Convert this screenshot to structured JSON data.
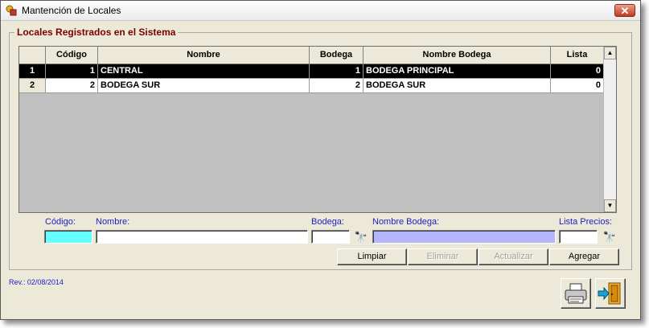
{
  "window": {
    "title": "Mantención de Locales"
  },
  "group": {
    "label": "Locales Registrados en el Sistema"
  },
  "grid": {
    "columns": [
      "",
      "Código",
      "Nombre",
      "Bodega",
      "Nombre Bodega",
      "Lista"
    ],
    "rows": [
      {
        "num": "1",
        "codigo": "1",
        "nombre": "CENTRAL",
        "bodega": "1",
        "nombre_bodega": "BODEGA PRINCIPAL",
        "lista": "0",
        "selected": true
      },
      {
        "num": "2",
        "codigo": "2",
        "nombre": "BODEGA SUR",
        "bodega": "2",
        "nombre_bodega": "BODEGA SUR",
        "lista": "0",
        "selected": false
      }
    ]
  },
  "form": {
    "codigo_label": "Código:",
    "nombre_label": "Nombre:",
    "bodega_label": "Bodega:",
    "nombre_bodega_label": "Nombre Bodega:",
    "lista_label": "Lista Precios:",
    "codigo_value": "",
    "nombre_value": "",
    "bodega_value": "",
    "nombre_bodega_value": "",
    "lista_value": ""
  },
  "buttons": {
    "limpiar": "Limpiar",
    "eliminar": "Eliminar",
    "actualizar": "Actualizar",
    "agregar": "Agregar"
  },
  "footer": {
    "revision": "Rev.: 02/08/2014"
  },
  "colors": {
    "codigo_field": "#66ffff",
    "nombre_bodega_field": "#b4b4ff",
    "group_label": "#7b0000",
    "field_label": "#1c1cc8"
  }
}
